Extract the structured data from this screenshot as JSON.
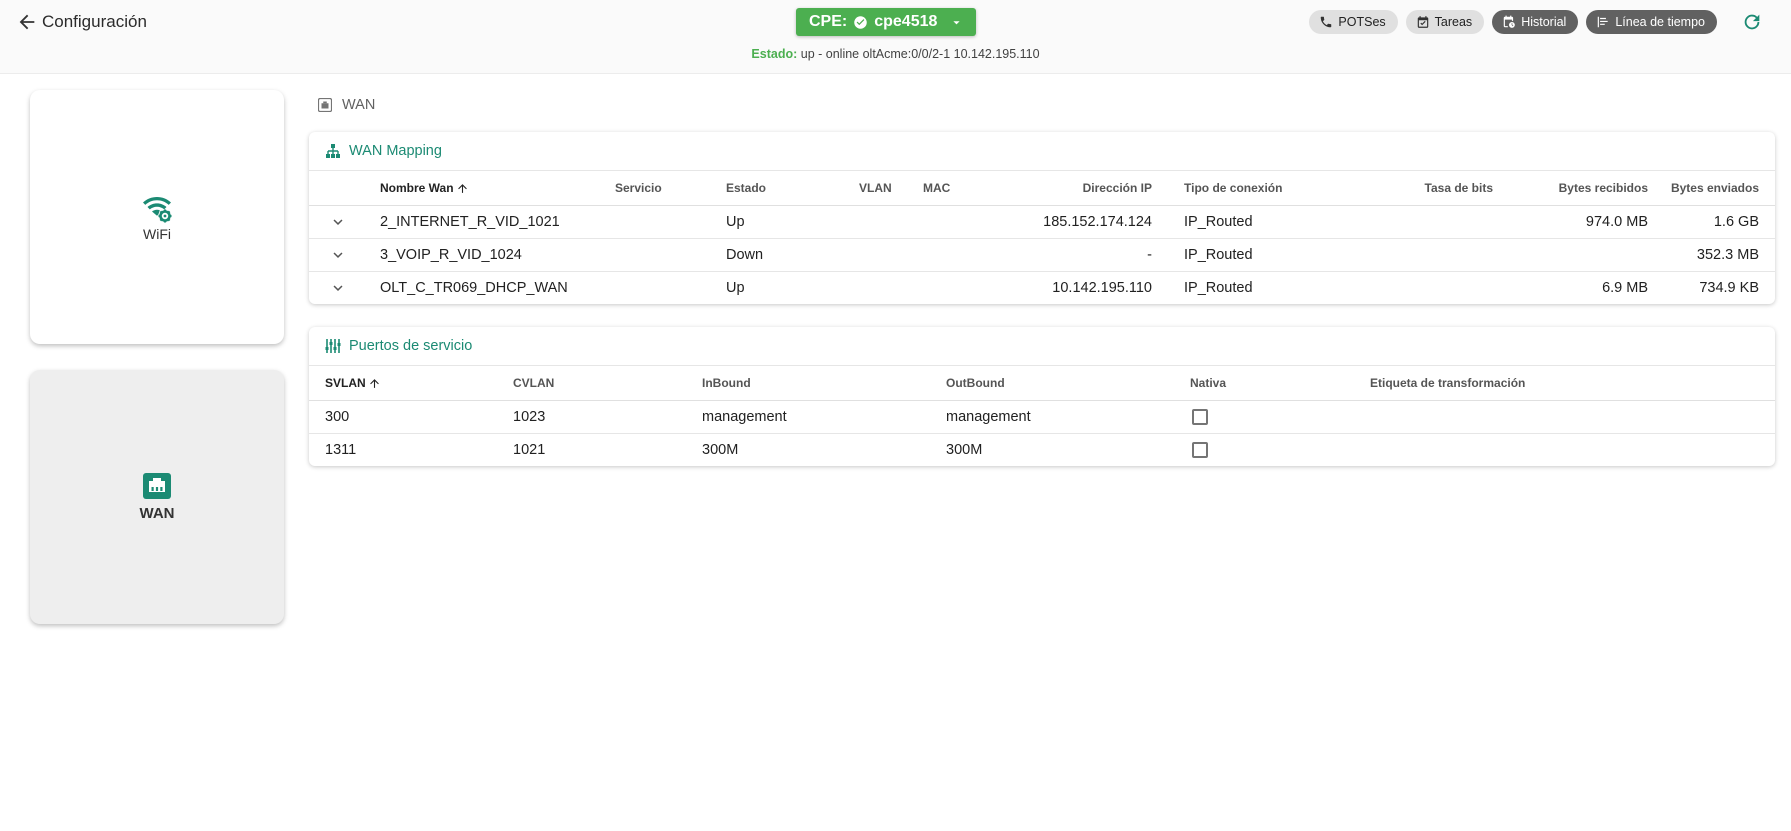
{
  "header": {
    "back_label": "Configuración",
    "cpe_label": "CPE:",
    "cpe_name": "cpe4518",
    "status_label": "Estado:",
    "status_value": "up - online oltAcme:0/0/2-1 10.142.195.110",
    "chips": {
      "pots": "POTSes",
      "tareas": "Tareas",
      "historial": "Historial",
      "timeline": "Línea de tiempo"
    }
  },
  "sidebar": {
    "wifi_label": "WiFi",
    "wan_label": "WAN"
  },
  "main": {
    "section_title": "WAN",
    "wan_mapping": {
      "title": "WAN Mapping",
      "columns": [
        "Nombre Wan",
        "Servicio",
        "Estado",
        "VLAN",
        "MAC",
        "Dirección IP",
        "Tipo de conexión",
        "Tasa de bits",
        "Bytes recibidos",
        "Bytes enviados"
      ],
      "rows": [
        {
          "name": "2_INTERNET_R_VID_1021",
          "servicio": "",
          "estado": "Up",
          "vlan": "",
          "mac": "",
          "ip": "185.152.174.124",
          "tipo": "IP_Routed",
          "tasa": "",
          "recibidos": "974.0 MB",
          "enviados": "1.6 GB"
        },
        {
          "name": "3_VOIP_R_VID_1024",
          "servicio": "",
          "estado": "Down",
          "vlan": "",
          "mac": "",
          "ip": "-",
          "tipo": "IP_Routed",
          "tasa": "",
          "recibidos": "",
          "enviados": "352.3 MB"
        },
        {
          "name": "OLT_C_TR069_DHCP_WAN",
          "servicio": "",
          "estado": "Up",
          "vlan": "",
          "mac": "",
          "ip": "10.142.195.110",
          "tipo": "IP_Routed",
          "tasa": "",
          "recibidos": "6.9 MB",
          "enviados": "734.9 KB"
        }
      ]
    },
    "service_ports": {
      "title": "Puertos de servicio",
      "columns": [
        "SVLAN",
        "CVLAN",
        "InBound",
        "OutBound",
        "Nativa",
        "Etiqueta de transformación"
      ],
      "rows": [
        {
          "svlan": "300",
          "cvlan": "1023",
          "inbound": "management",
          "outbound": "management",
          "nativa": false,
          "etiqueta": ""
        },
        {
          "svlan": "1311",
          "cvlan": "1021",
          "inbound": "300M",
          "outbound": "300M",
          "nativa": false,
          "etiqueta": ""
        }
      ]
    }
  },
  "colors": {
    "accent": "#1b8a73",
    "success": "#4caf50",
    "chip_dark": "#616161",
    "chip_light": "#e0e0e0"
  }
}
